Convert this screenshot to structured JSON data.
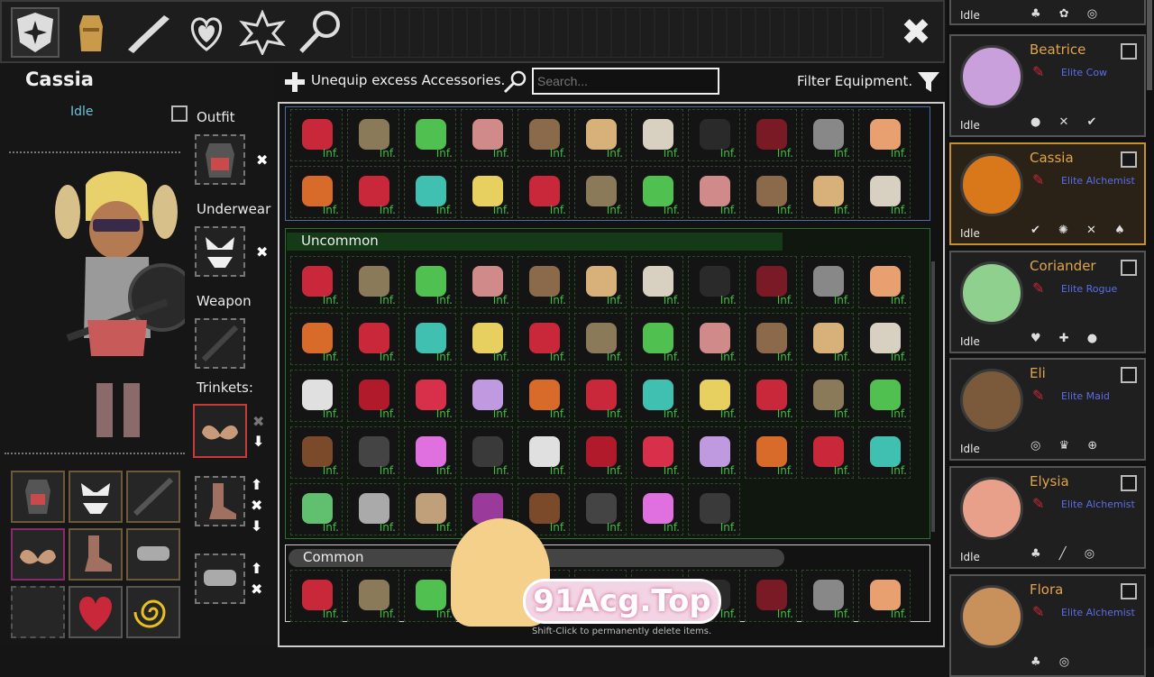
{
  "topbar": {
    "icons": [
      "compass-shield-icon",
      "outfit-icon",
      "rifle-icon",
      "heart-collar-icon",
      "star-icon",
      "magnifier-icon"
    ],
    "close_label": "✖"
  },
  "character": {
    "name": "Cassia",
    "status": "Idle"
  },
  "slots": {
    "outfit": "Outfit",
    "underwear": "Underwear",
    "weapon": "Weapon",
    "trinkets": "Trinkets:"
  },
  "toolbar": {
    "unequip": "Unequip excess Accessories.",
    "search_placeholder": "Search...",
    "filter": "Filter Equipment."
  },
  "sections": {
    "uncommon": "Uncommon",
    "common": "Common"
  },
  "inf": "Inf.",
  "hint": "Shift-Click to permanently delete items.",
  "watermark": "91Acg.Top",
  "roster": [
    {
      "name": "",
      "status": "Idle",
      "role": ""
    },
    {
      "name": "Beatrice",
      "status": "Idle",
      "role": "Elite Cow",
      "color": "#c9a0dc"
    },
    {
      "name": "Cassia",
      "status": "Idle",
      "role": "Elite Alchemist",
      "color": "#d9781a"
    },
    {
      "name": "Coriander",
      "status": "Idle",
      "role": "Elite Rogue",
      "color": "#8fd08f"
    },
    {
      "name": "Eli",
      "status": "Idle",
      "role": "Elite Maid",
      "color": "#7a5a3a"
    },
    {
      "name": "Elysia",
      "status": "Idle",
      "role": "Elite Alchemist",
      "color": "#e8a08a"
    },
    {
      "name": "Flora",
      "status": "",
      "role": "Elite Alchemist",
      "color": "#c8905a"
    }
  ]
}
